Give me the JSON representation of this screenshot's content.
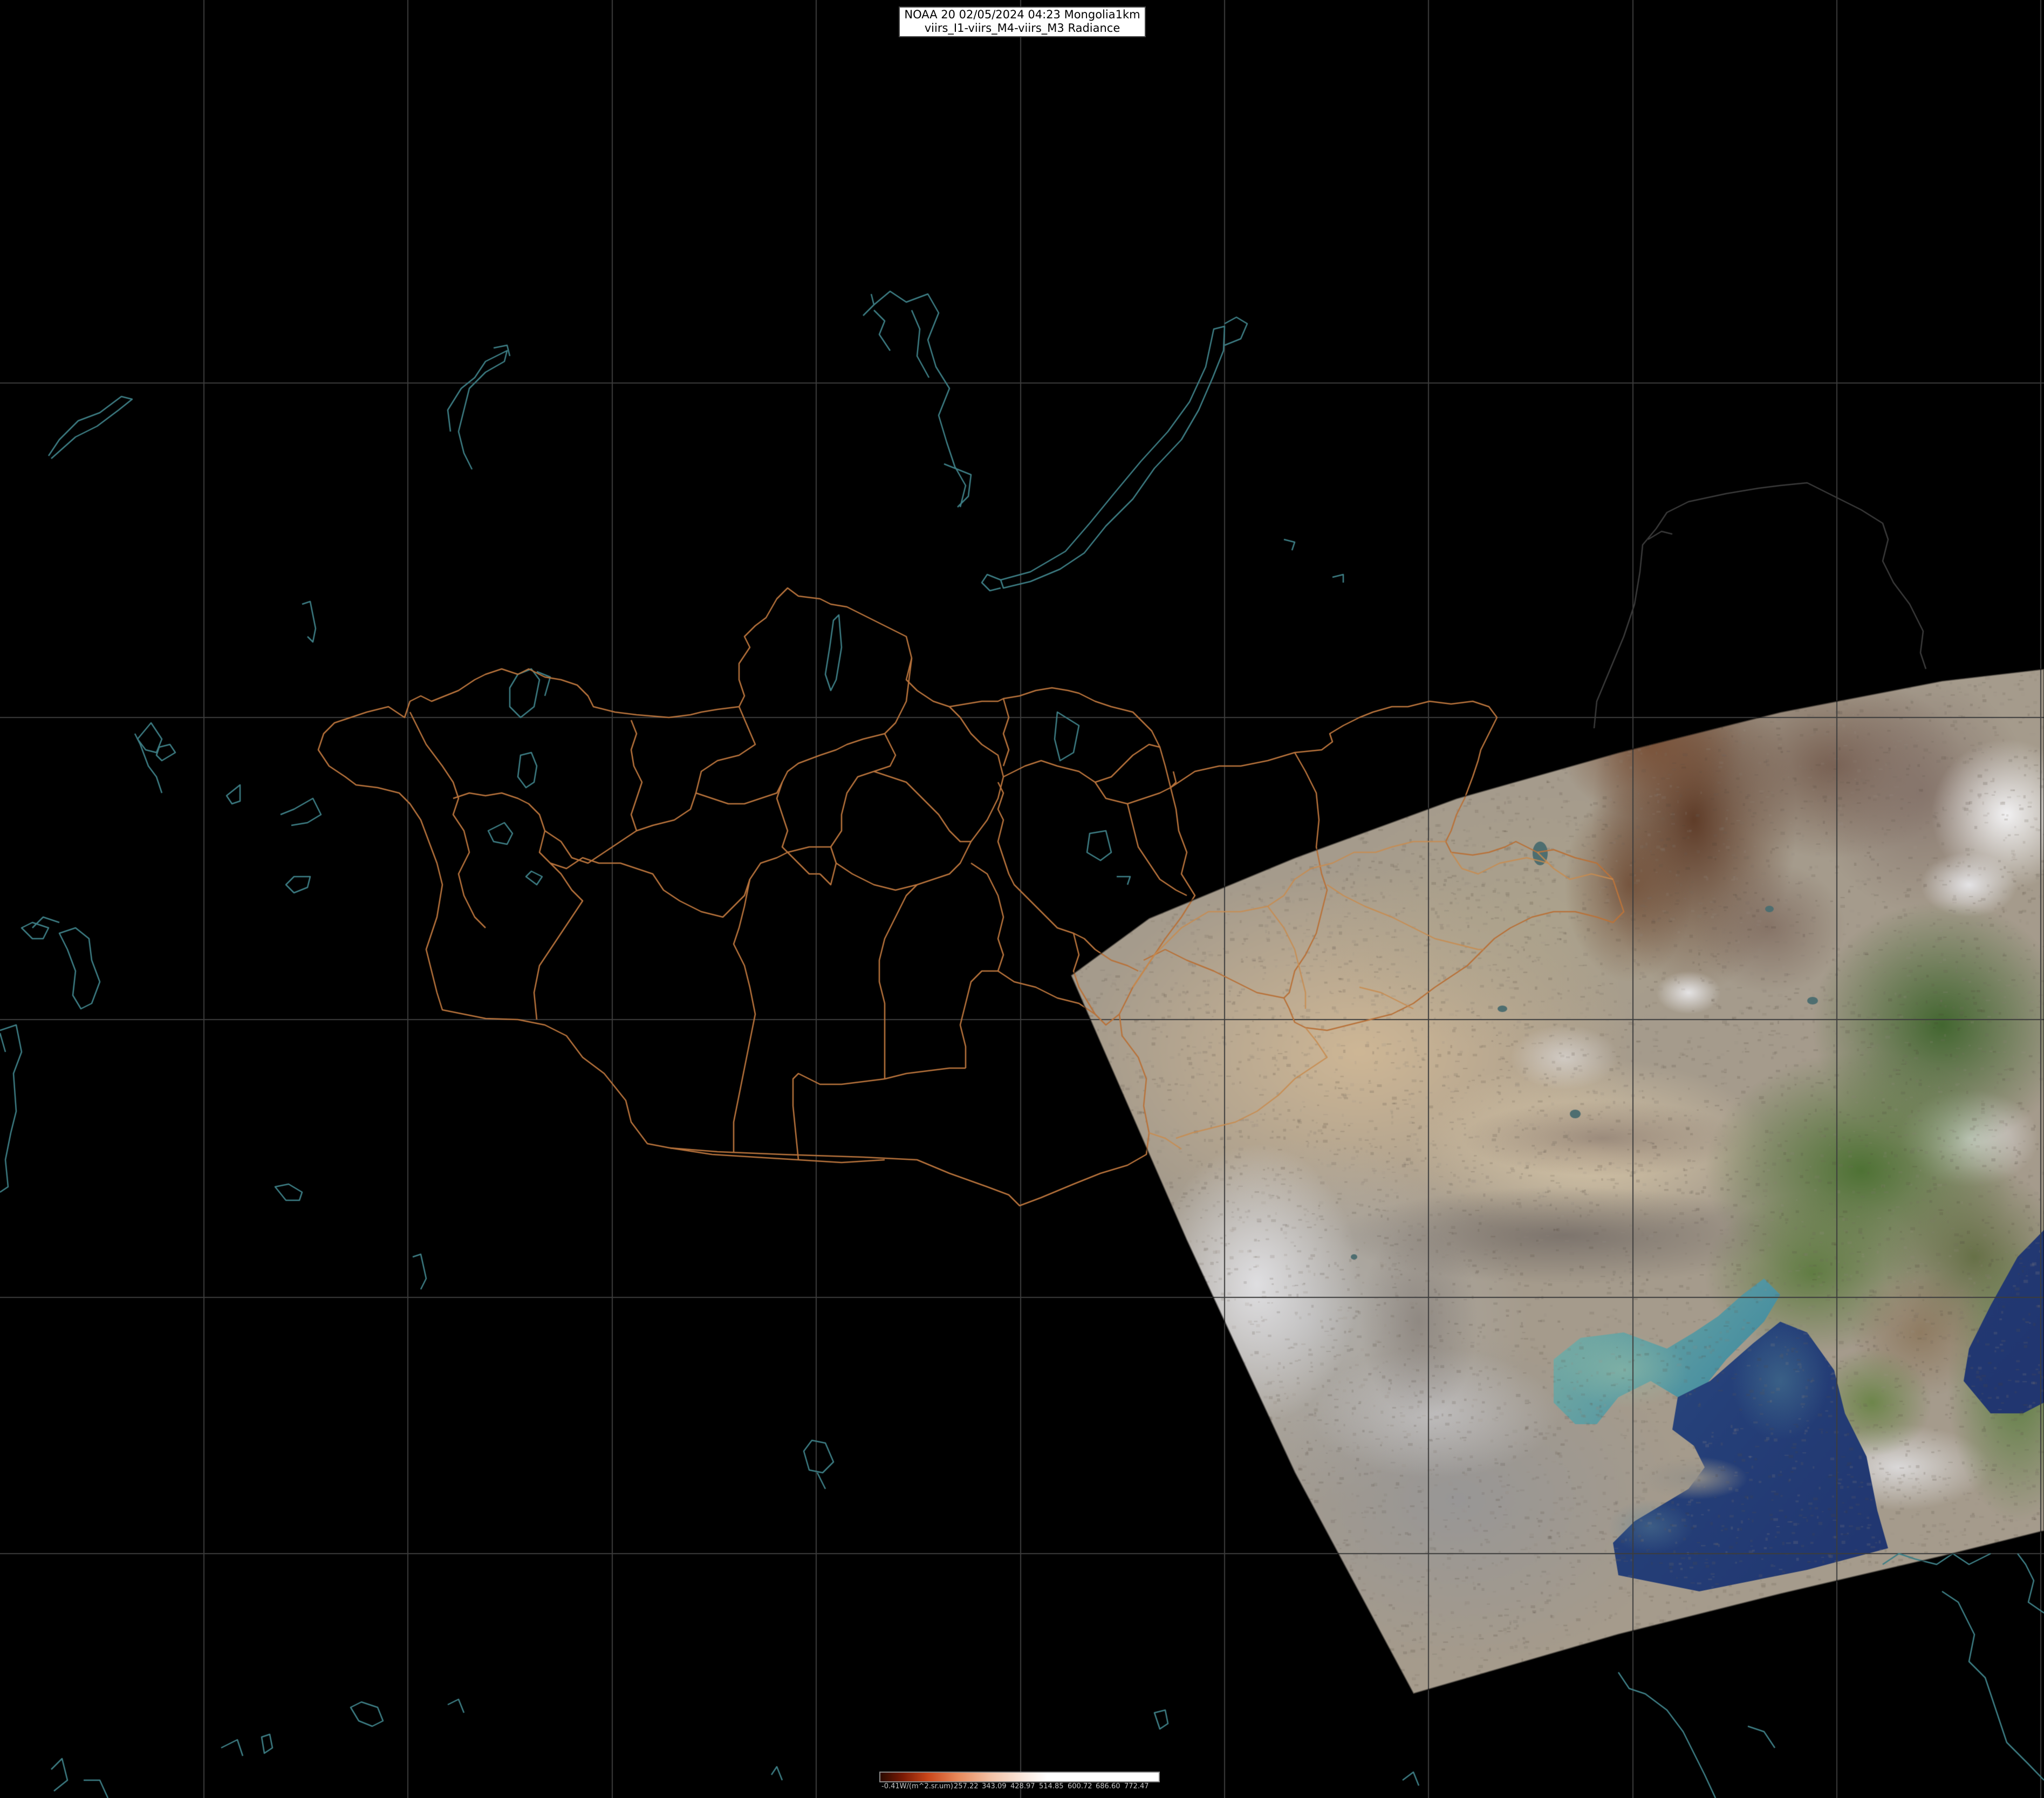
{
  "header": {
    "line1": "NOAA 20 02/05/2024 04:23 Mongolia1km",
    "line2": "viirs_I1-viirs_M4-viirs_M3 Radiance"
  },
  "colorbar": {
    "unit_label": "-0.41W/(m^2.sr.um)",
    "ticks": [
      "257.22",
      "343.09",
      "428.97",
      "514.85",
      "600.72",
      "686.60",
      "772.47"
    ]
  },
  "colors": {
    "background": "#000000",
    "graticule": "#3c3c3c",
    "coastline": "#3e7f86",
    "admin_border": "#b8733c"
  },
  "map_layers": [
    "graticule",
    "coastlines-and-lakes",
    "mongolia-aimag-borders",
    "viirs-true-color-swath",
    "colorbar"
  ]
}
